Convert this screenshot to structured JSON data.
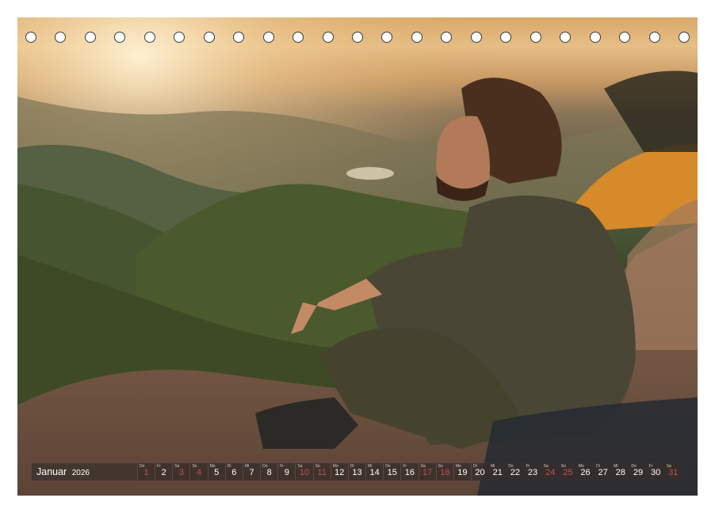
{
  "calendar": {
    "month": "Januar",
    "year": "2026",
    "days": [
      {
        "n": "1",
        "wd": "Do",
        "we": true
      },
      {
        "n": "2",
        "wd": "Fr",
        "we": false
      },
      {
        "n": "3",
        "wd": "Sa",
        "we": true
      },
      {
        "n": "4",
        "wd": "So",
        "we": true
      },
      {
        "n": "5",
        "wd": "Mo",
        "we": false
      },
      {
        "n": "6",
        "wd": "Di",
        "we": false
      },
      {
        "n": "7",
        "wd": "Mi",
        "we": false
      },
      {
        "n": "8",
        "wd": "Do",
        "we": false
      },
      {
        "n": "9",
        "wd": "Fr",
        "we": false
      },
      {
        "n": "10",
        "wd": "Sa",
        "we": true
      },
      {
        "n": "11",
        "wd": "So",
        "we": true
      },
      {
        "n": "12",
        "wd": "Mo",
        "we": false
      },
      {
        "n": "13",
        "wd": "Di",
        "we": false
      },
      {
        "n": "14",
        "wd": "Mi",
        "we": false
      },
      {
        "n": "15",
        "wd": "Do",
        "we": false
      },
      {
        "n": "16",
        "wd": "Fr",
        "we": false
      },
      {
        "n": "17",
        "wd": "Sa",
        "we": true
      },
      {
        "n": "18",
        "wd": "So",
        "we": true
      },
      {
        "n": "19",
        "wd": "Mo",
        "we": false
      },
      {
        "n": "20",
        "wd": "Di",
        "we": false
      },
      {
        "n": "21",
        "wd": "Mi",
        "we": false
      },
      {
        "n": "22",
        "wd": "Do",
        "we": false
      },
      {
        "n": "23",
        "wd": "Fr",
        "we": false
      },
      {
        "n": "24",
        "wd": "Sa",
        "we": true
      },
      {
        "n": "25",
        "wd": "So",
        "we": true
      },
      {
        "n": "26",
        "wd": "Mo",
        "we": false
      },
      {
        "n": "27",
        "wd": "Di",
        "we": false
      },
      {
        "n": "28",
        "wd": "Mi",
        "we": false
      },
      {
        "n": "29",
        "wd": "Do",
        "we": false
      },
      {
        "n": "30",
        "wd": "Fr",
        "we": false
      },
      {
        "n": "31",
        "wd": "Sa",
        "we": true
      }
    ]
  },
  "colors": {
    "weekend": "#c0504d",
    "weekday": "#ffffff",
    "bar": "#372d2a"
  }
}
